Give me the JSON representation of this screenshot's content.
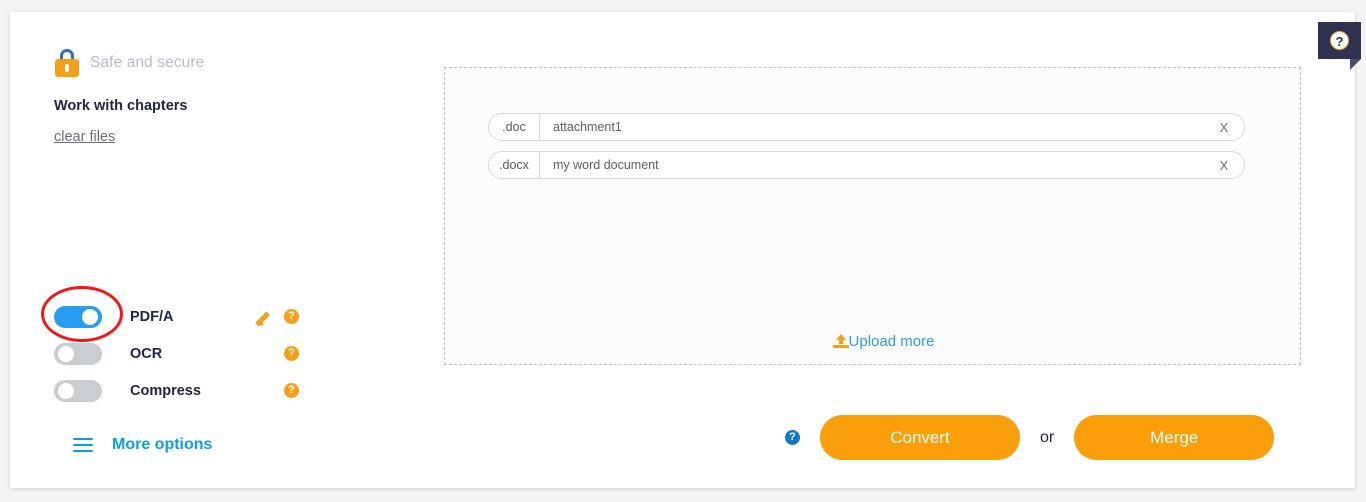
{
  "left_panel": {
    "safe_text": "Safe and secure",
    "lock_icon": "lock-icon",
    "chapters_label": "Work with chapters",
    "clear_files_label": "clear files"
  },
  "options": {
    "items": [
      {
        "label": "PDF/A",
        "state": "on",
        "has_edit": true,
        "help": "?"
      },
      {
        "label": "OCR",
        "state": "off",
        "has_edit": false,
        "help": "?"
      },
      {
        "label": "Compress",
        "state": "off",
        "has_edit": false,
        "help": "?"
      }
    ],
    "edit_icon": "pencil-icon",
    "help_icon": "help-icon",
    "annotation": "red-highlight-circle"
  },
  "more_options": {
    "label": "More options",
    "icon": "hamburger-icon"
  },
  "dropzone": {
    "files": [
      {
        "ext": ".doc",
        "name": "attachment1",
        "remove": "X"
      },
      {
        "ext": ".docx",
        "name": "my word document",
        "remove": "X"
      }
    ],
    "upload_more_label": "Upload more",
    "upload_icon": "upload-icon"
  },
  "actions": {
    "help": "?",
    "convert_label": "Convert",
    "or_label": "or",
    "merge_label": "Merge"
  },
  "help_tab": {
    "icon_label": "?"
  },
  "colors": {
    "orange": "#fa9e0a",
    "blue": "#0c9ee4",
    "toggle_on": "#279cf0",
    "toggle_off": "#c9ccd1",
    "navy": "#23244a",
    "annotation_red": "#f41616",
    "help_tab_bg": "#2f3253"
  }
}
